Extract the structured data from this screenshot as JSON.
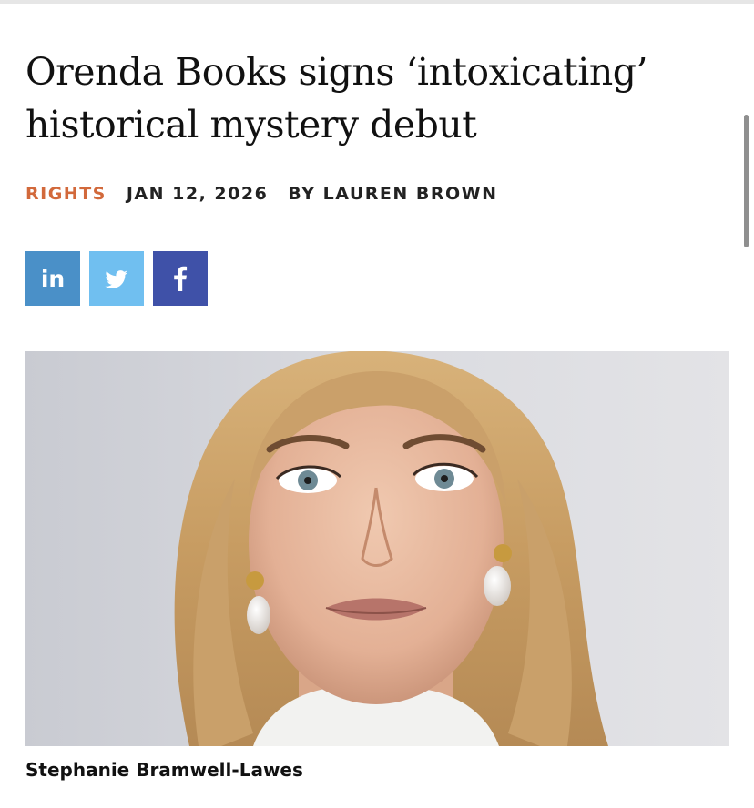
{
  "article": {
    "title": "Orenda Books signs ‘intoxicating’ historical mystery debut",
    "category": "RIGHTS",
    "date": "JAN 12, 2026",
    "byline": "BY LAUREN BROWN"
  },
  "share": {
    "buttons": [
      {
        "network": "linkedin",
        "icon": "linkedin-icon",
        "color": "#4a90c8"
      },
      {
        "network": "twitter",
        "icon": "twitter-icon",
        "color": "#70bff0"
      },
      {
        "network": "facebook",
        "icon": "facebook-icon",
        "color": "#3f51a8"
      }
    ]
  },
  "image": {
    "caption": "Stephanie Bramwell-Lawes"
  },
  "colors": {
    "category": "#d2693b",
    "text": "#111111"
  }
}
